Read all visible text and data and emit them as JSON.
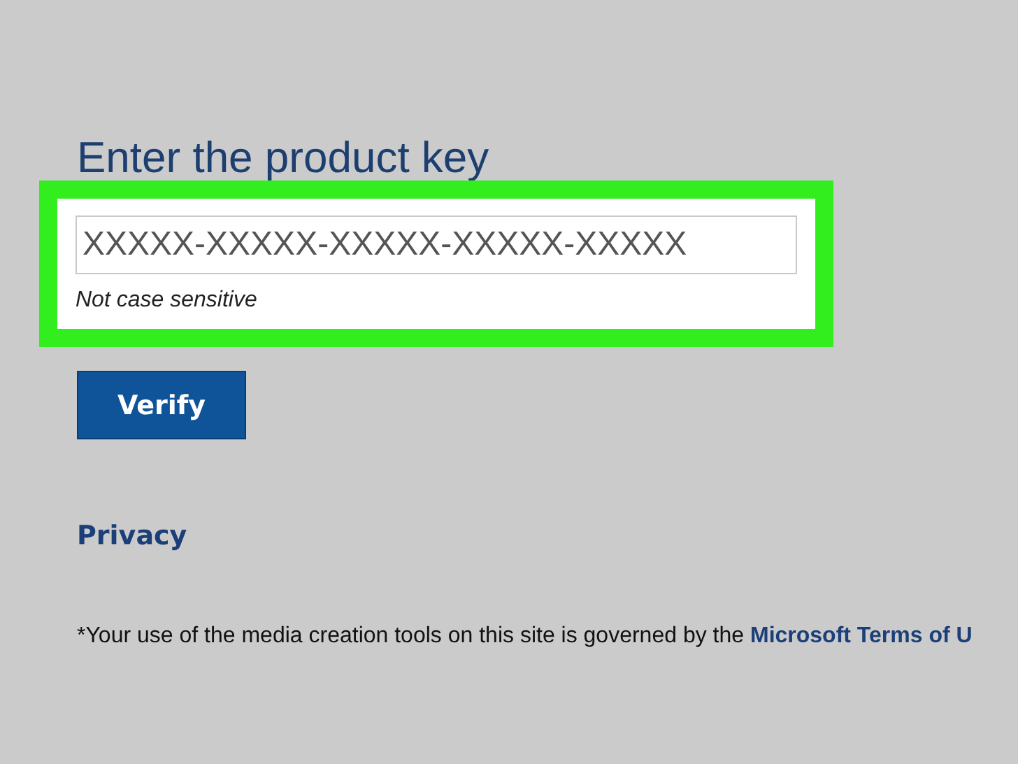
{
  "heading": "Enter the product key",
  "key_field": {
    "placeholder": "XXXXX-XXXXX-XXXXX-XXXXX-XXXXX",
    "hint": "Not case sensitive",
    "highlighted": true
  },
  "verify_button": "Verify",
  "privacy_link": "Privacy",
  "footer": {
    "text": "*Your use of the media creation tools on this site is governed by the ",
    "link": "Microsoft Terms of U"
  }
}
